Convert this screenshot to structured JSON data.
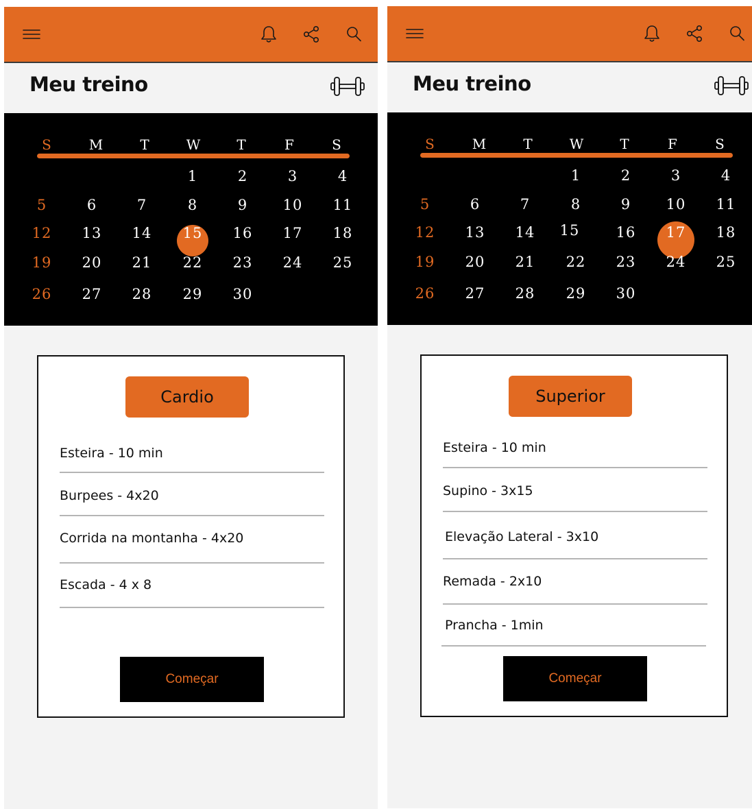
{
  "screens": [
    {
      "title": "Meu treino",
      "calendar": {
        "weekdays": [
          "S",
          "M",
          "T",
          "W",
          "T",
          "F",
          "S"
        ],
        "weeks": [
          [
            "",
            "",
            "",
            "1",
            "2",
            "3",
            "4"
          ],
          [
            "5",
            "6",
            "7",
            "8",
            "9",
            "10",
            "11"
          ],
          [
            "12",
            "13",
            "14",
            "15",
            "16",
            "17",
            "18"
          ],
          [
            "19",
            "20",
            "21",
            "22",
            "23",
            "24",
            "25"
          ],
          [
            "26",
            "27",
            "28",
            "29",
            "30",
            "",
            ""
          ]
        ],
        "selected_day": "15"
      },
      "workout": {
        "category": "Cardio",
        "exercises": [
          "Esteira - 10 min",
          "Burpees - 4x20",
          "Corrida na montanha - 4x20",
          "Escada - 4 x 8"
        ],
        "start_label": "Começar"
      }
    },
    {
      "title": "Meu treino",
      "calendar": {
        "weekdays": [
          "S",
          "M",
          "T",
          "W",
          "T",
          "F",
          "S"
        ],
        "weeks": [
          [
            "",
            "",
            "",
            "1",
            "2",
            "3",
            "4"
          ],
          [
            "5",
            "6",
            "7",
            "8",
            "9",
            "10",
            "11"
          ],
          [
            "12",
            "13",
            "14",
            "15",
            "16",
            "17",
            "18"
          ],
          [
            "19",
            "20",
            "21",
            "22",
            "23",
            "24",
            "25"
          ],
          [
            "26",
            "27",
            "28",
            "29",
            "30",
            "",
            ""
          ]
        ],
        "selected_day": "17"
      },
      "workout": {
        "category": "Superior",
        "exercises": [
          "Esteira - 10 min",
          "Supino - 3x15",
          "Elevação Lateral - 3x10",
          "Remada - 2x10",
          "Prancha - 1min"
        ],
        "start_label": "Começar"
      }
    }
  ],
  "icons": {
    "menu": "hamburger-menu-icon",
    "notifications": "bell-icon",
    "share": "share-icon",
    "search": "search-icon",
    "workout": "dumbbell-icon"
  },
  "colors": {
    "accent": "#e26a22",
    "calendar_bg": "#000000",
    "page_bg": "#f3f3f3",
    "text": "#111111"
  }
}
